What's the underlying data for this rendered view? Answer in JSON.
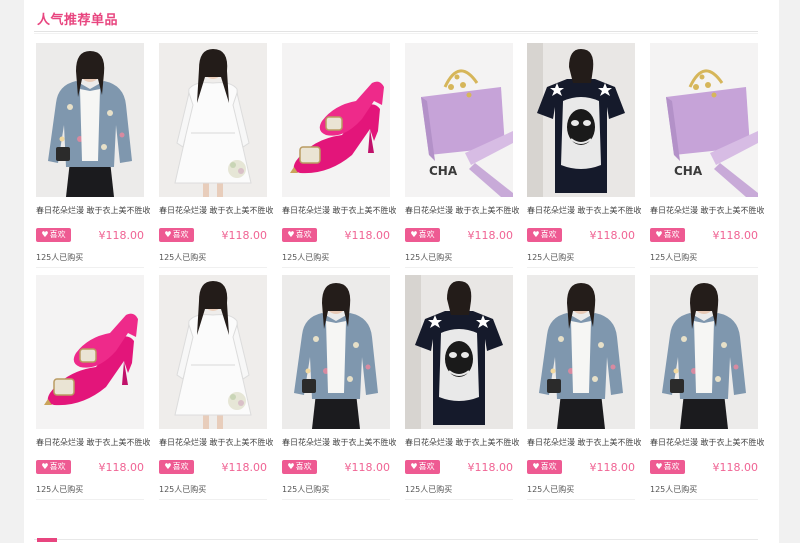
{
  "section": {
    "title": "人气推荐单品"
  },
  "colors": {
    "accent": "#e8457f",
    "button": "#ee5a92",
    "price": "#f06494"
  },
  "products": [
    {
      "name": "春日花朵烂漫 敢于衣上美不胜收",
      "like_label": "喜欢",
      "price": "¥118.00",
      "sold": "125人已购买",
      "image": "floral-jacket"
    },
    {
      "name": "春日花朵烂漫 敢于衣上美不胜收",
      "like_label": "喜欢",
      "price": "¥118.00",
      "sold": "125人已购买",
      "image": "white-dress"
    },
    {
      "name": "春日花朵烂漫 敢于衣上美不胜收",
      "like_label": "喜欢",
      "price": "¥118.00",
      "sold": "125人已购买",
      "image": "pink-shoes"
    },
    {
      "name": "春日花朵烂漫 敢于衣上美不胜收",
      "like_label": "喜欢",
      "price": "¥118.00",
      "sold": "125人已购买",
      "image": "lilac-bag"
    },
    {
      "name": "春日花朵烂漫 敢于衣上美不胜收",
      "like_label": "喜欢",
      "price": "¥118.00",
      "sold": "125人已购买",
      "image": "print-tee-dress"
    },
    {
      "name": "春日花朵烂漫 敢于衣上美不胜收",
      "like_label": "喜欢",
      "price": "¥118.00",
      "sold": "125人已购买",
      "image": "lilac-bag"
    },
    {
      "name": "春日花朵烂漫 敢于衣上美不胜收",
      "like_label": "喜欢",
      "price": "¥118.00",
      "sold": "125人已购买",
      "image": "pink-shoes"
    },
    {
      "name": "春日花朵烂漫 敢于衣上美不胜收",
      "like_label": "喜欢",
      "price": "¥118.00",
      "sold": "125人已购买",
      "image": "white-dress"
    },
    {
      "name": "春日花朵烂漫 敢于衣上美不胜收",
      "like_label": "喜欢",
      "price": "¥118.00",
      "sold": "125人已购买",
      "image": "floral-jacket"
    },
    {
      "name": "春日花朵烂漫 敢于衣上美不胜收",
      "like_label": "喜欢",
      "price": "¥118.00",
      "sold": "125人已购买",
      "image": "print-tee-dress"
    },
    {
      "name": "春日花朵烂漫 敢于衣上美不胜收",
      "like_label": "喜欢",
      "price": "¥118.00",
      "sold": "125人已购买",
      "image": "floral-jacket"
    },
    {
      "name": "春日花朵烂漫 敢于衣上美不胜收",
      "like_label": "喜欢",
      "price": "¥118.00",
      "sold": "125人已购买",
      "image": "floral-jacket"
    }
  ]
}
